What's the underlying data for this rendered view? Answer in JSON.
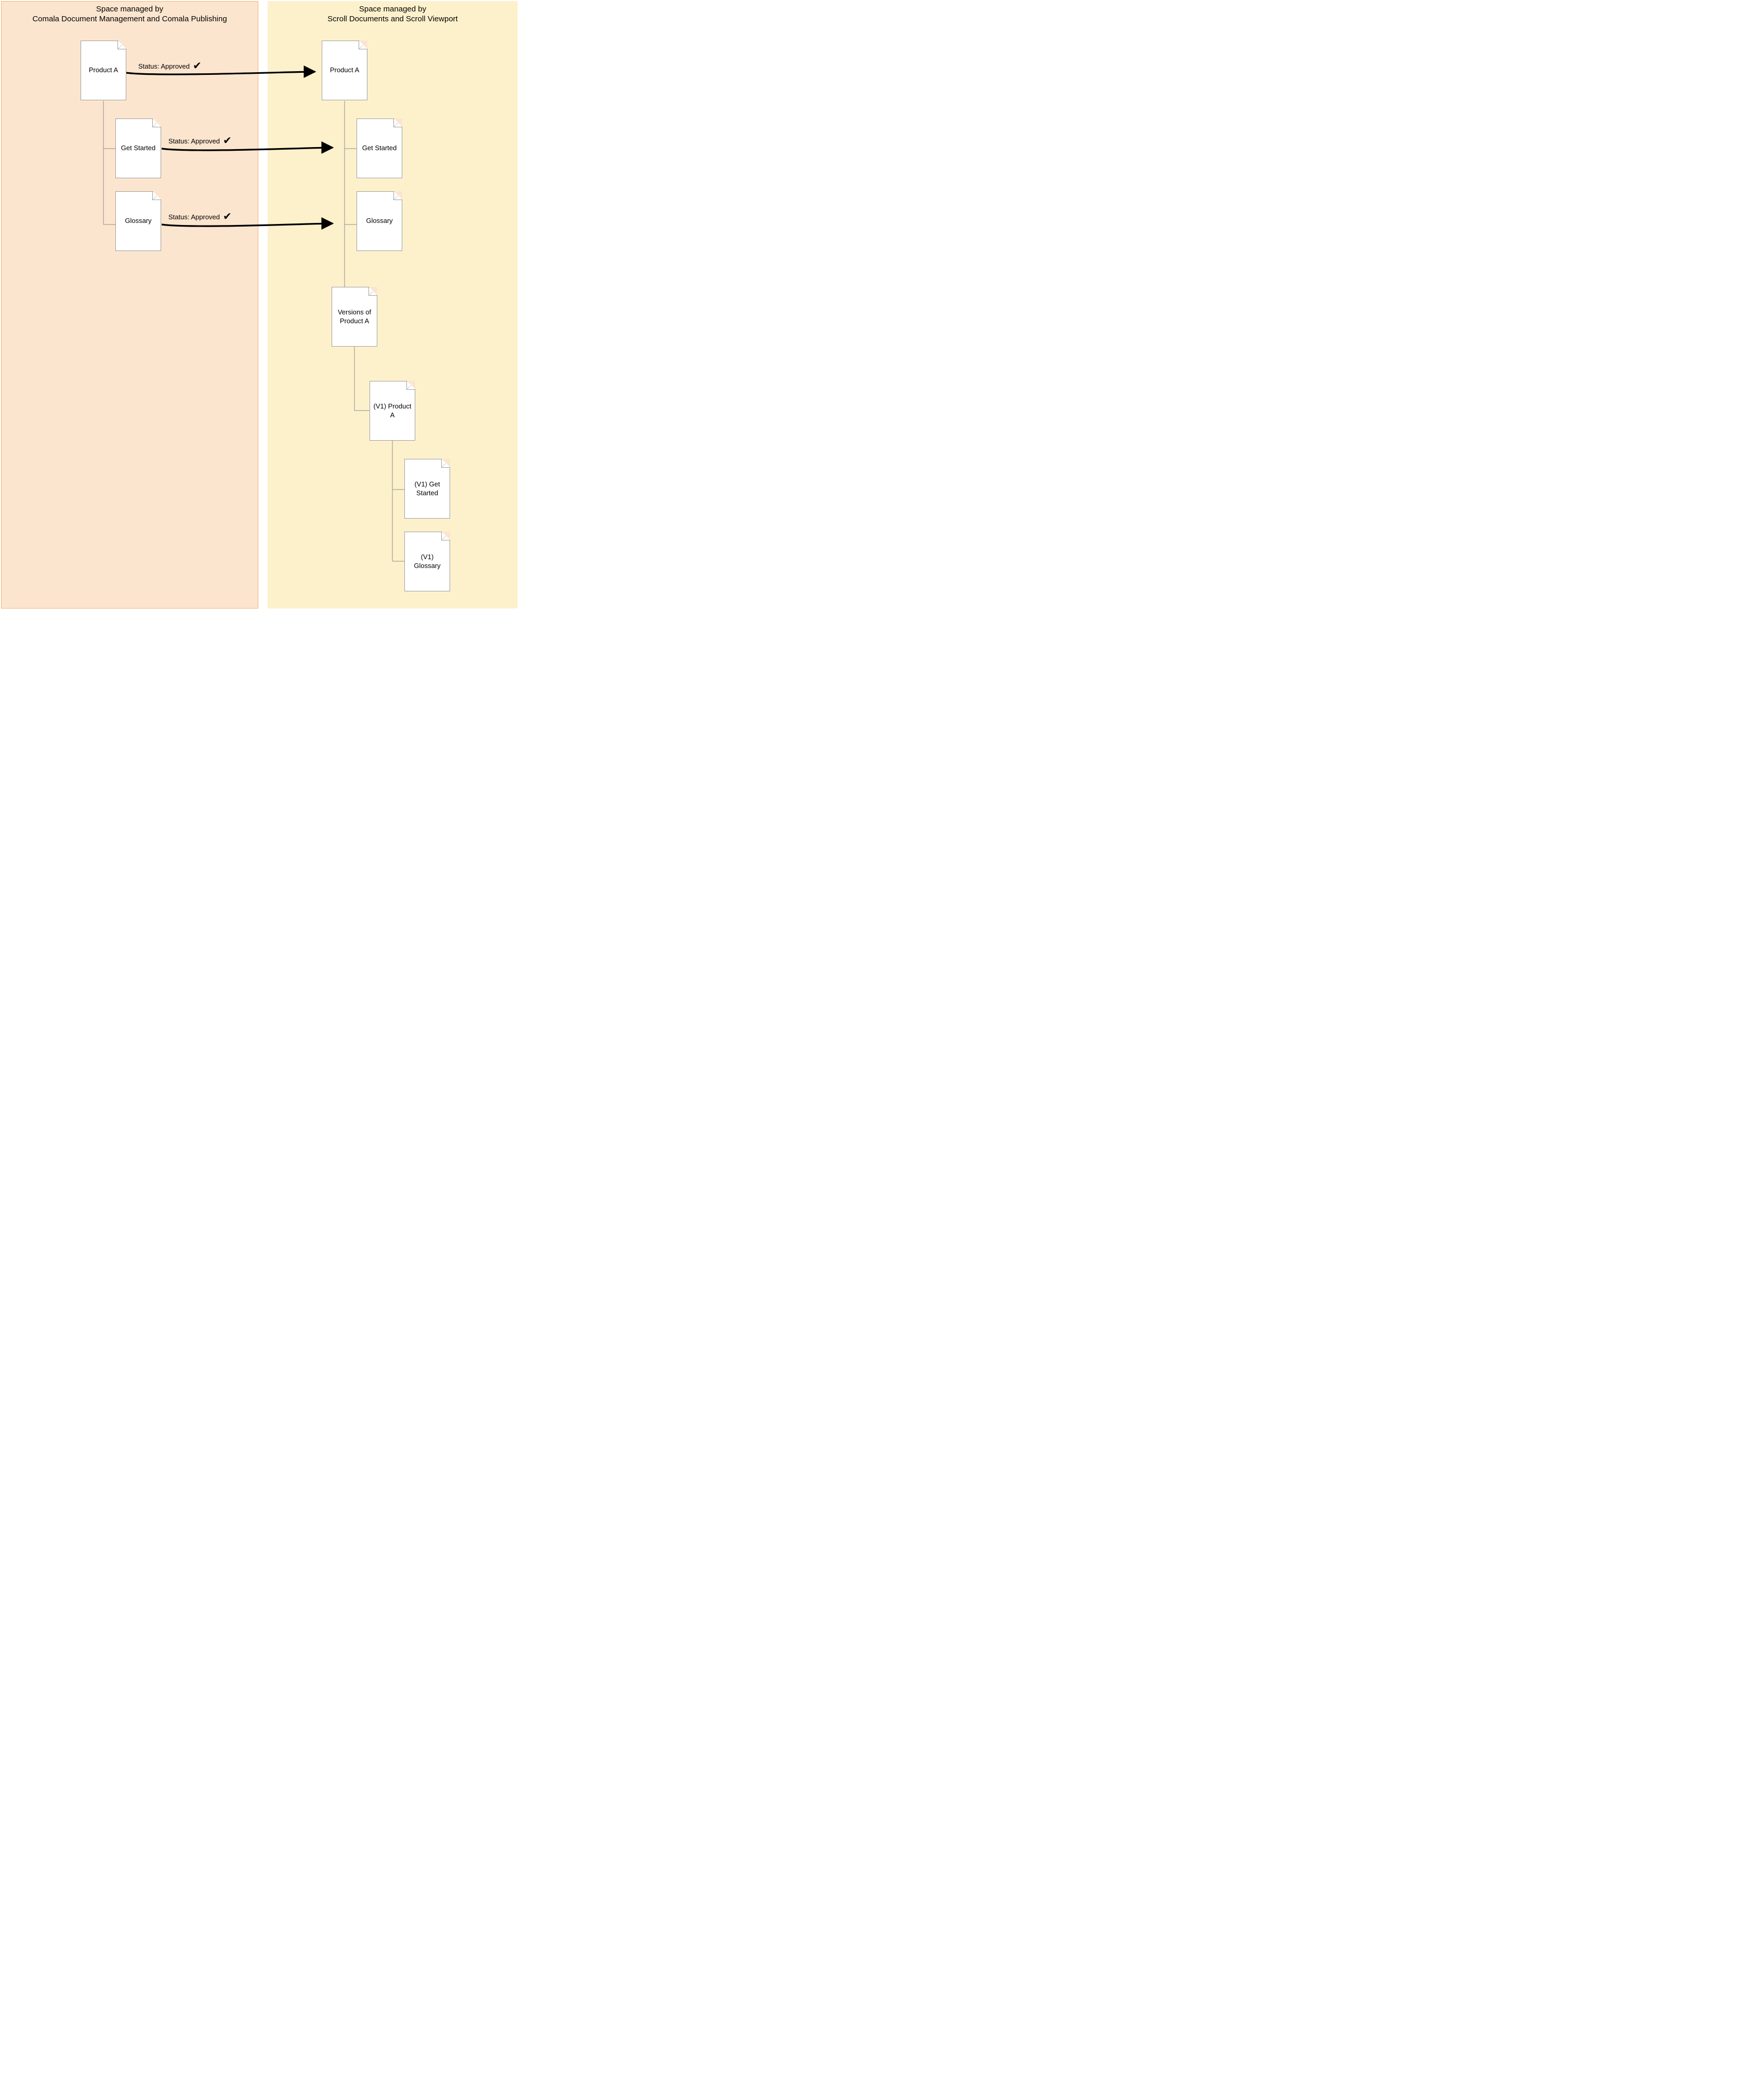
{
  "left": {
    "title_line1": "Space managed by",
    "title_line2": "Comala Document Management and Comala Publishing",
    "pages": {
      "productA": "Product A",
      "getStarted": "Get Started",
      "glossary": "Glossary"
    }
  },
  "right": {
    "title_line1": "Space managed by",
    "title_line2": "Scroll Documents and Scroll Viewport",
    "pages": {
      "productA": "Product A",
      "getStarted": "Get Started",
      "glossary": "Glossary",
      "versions": "Versions of Product A",
      "v1ProductA": "(V1) Product A",
      "v1GetStarted": "(V1) Get Started",
      "v1Glossary": "(V1) Glossary"
    }
  },
  "edgeLabel": "Status: Approved",
  "checkGlyph": "✔"
}
